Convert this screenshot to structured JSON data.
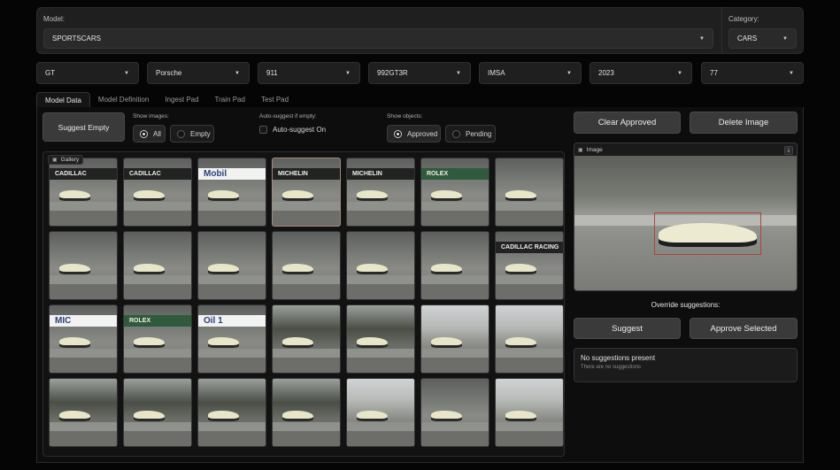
{
  "top": {
    "model_label": "Model:",
    "model_value": "SPORTSCARS",
    "category_label": "Category:",
    "category_value": "CARS"
  },
  "filters": [
    "GT",
    "Porsche",
    "911",
    "992GT3R",
    "IMSA",
    "2023",
    "77"
  ],
  "tabs": [
    "Model Data",
    "Model Definition",
    "Ingest Pad",
    "Train Pad",
    "Test Pad"
  ],
  "active_tab": "Model Data",
  "controls": {
    "suggest_empty": "Suggest Empty",
    "show_images_label": "Show images:",
    "show_images_options": [
      "All",
      "Empty"
    ],
    "show_images_selected": "All",
    "auto_suggest_label": "Auto-suggest if empty:",
    "auto_suggest_option": "Auto-suggest On",
    "show_objects_label": "Show objects:",
    "show_objects_options": [
      "Approved",
      "Pending"
    ],
    "show_objects_selected": "Approved"
  },
  "gallery": {
    "label": "Gallery",
    "rows": [
      [
        {
          "banner": "CADILLAC",
          "style": "dark"
        },
        {
          "banner": "CADILLAC",
          "style": "dark"
        },
        {
          "banner": "Mobil",
          "style": "white"
        },
        {
          "banner": "MICHELIN",
          "style": "dark",
          "selected": true
        },
        {
          "banner": "MICHELIN",
          "style": "dark"
        },
        {
          "banner": "ROLEX",
          "style": "green"
        },
        {
          "banner": "",
          "style": "none"
        }
      ],
      [
        {
          "banner": "",
          "style": "none"
        },
        {
          "banner": "",
          "style": "none"
        },
        {
          "banner": "",
          "style": "none"
        },
        {
          "banner": "",
          "style": "none"
        },
        {
          "banner": "",
          "style": "none"
        },
        {
          "banner": "",
          "style": "none"
        },
        {
          "banner": "CADILLAC RACING",
          "style": "dark"
        }
      ],
      [
        {
          "banner": "MIC",
          "style": "white"
        },
        {
          "banner": "ROLEX",
          "style": "green"
        },
        {
          "banner": "Oil 1",
          "style": "white"
        },
        {
          "banner": "",
          "style": "trees"
        },
        {
          "banner": "",
          "style": "trees"
        },
        {
          "banner": "",
          "style": "open"
        },
        {
          "banner": "",
          "style": "open"
        }
      ],
      [
        {
          "banner": "",
          "style": "trees"
        },
        {
          "banner": "",
          "style": "trees"
        },
        {
          "banner": "",
          "style": "trees"
        },
        {
          "banner": "",
          "style": "trees"
        },
        {
          "banner": "",
          "style": "open"
        },
        {
          "banner": "",
          "style": "none"
        },
        {
          "banner": "",
          "style": "open"
        }
      ]
    ]
  },
  "right": {
    "clear_approved": "Clear Approved",
    "delete_image": "Delete Image",
    "image_label": "Image",
    "override_label": "Override suggestions:",
    "suggest": "Suggest",
    "approve_selected": "Approve Selected",
    "no_suggestions_title": "No suggestions present",
    "no_suggestions_sub": "There are no suggestions"
  },
  "icons": {
    "dropdown": "chevron-down-icon",
    "gallery": "image-icon",
    "download": "download-icon"
  },
  "colors": {
    "background": "#050505",
    "panel": "#1f1f1f",
    "button": "#3a3a3a",
    "bbox": "#b0443a"
  }
}
